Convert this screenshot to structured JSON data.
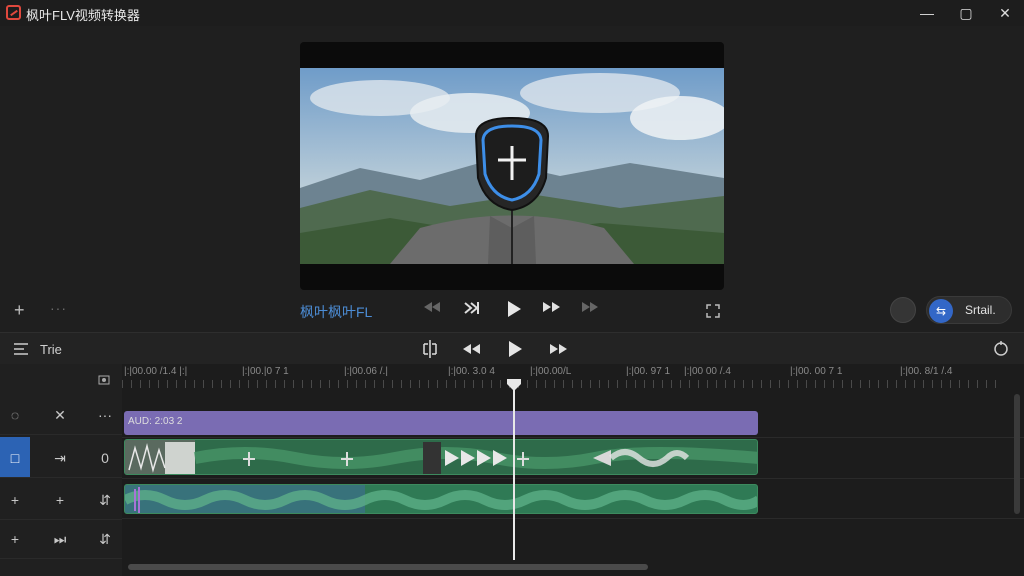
{
  "app": {
    "title": "枫叶FLV视频转换器"
  },
  "window": {
    "minimize": "—",
    "maximize": "▢",
    "close": "✕"
  },
  "preview": {
    "clip_label": "枫叶枫叶FL",
    "export_label": "Srtail.",
    "export_icon": "⇆"
  },
  "timeline": {
    "toolbar_label": "Trie",
    "ruler_labels": [
      "|:|00.00 /1.4 |:|",
      "|:|00.|0 7 1",
      "|:|00.06 /.|",
      "|:|00. 3.0 4",
      "|:|00.00/L",
      "|:|00. 97 1",
      "|:|00 00 /.4",
      "|:|00. 00 7 1",
      "|:|00. 8/1 /.4"
    ],
    "purple_clip_label": "AUD: 2:03 2",
    "track_headers": [
      {
        "left": "◌",
        "mid": "✕",
        "right": "···"
      },
      {
        "left": "□",
        "mid": "⇥",
        "right": "0"
      },
      {
        "left": "+",
        "mid": "+",
        "right": "⇵"
      },
      {
        "left": "+",
        "mid": "⏭",
        "right": "⇵"
      }
    ]
  },
  "colors": {
    "accent": "#2c63b4",
    "purple_clip": "#7a6cb3",
    "green_clip": "#2f7a55",
    "label_blue": "#4c8dd6"
  }
}
